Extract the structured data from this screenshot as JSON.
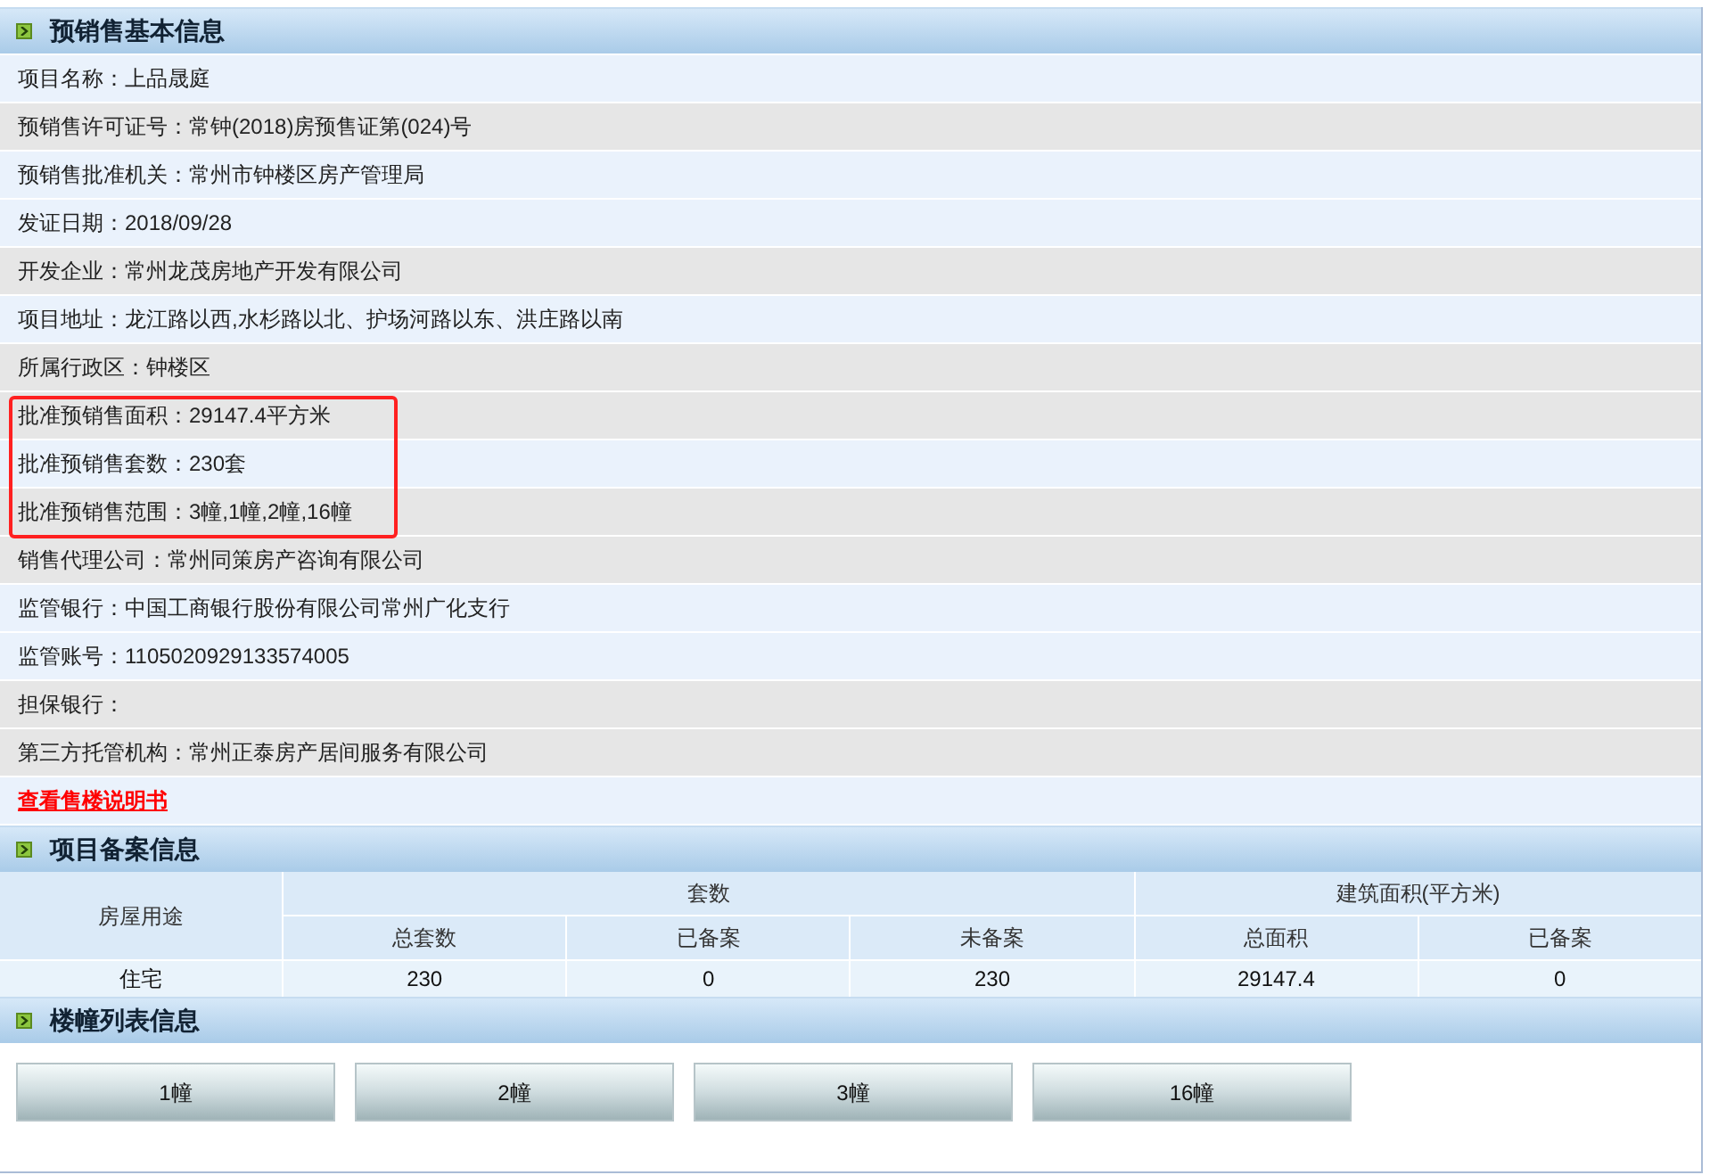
{
  "basic_info": {
    "title": "预销售基本信息",
    "rows": [
      {
        "kind": "field",
        "label": "项目名称：",
        "value": "上品晟庭",
        "color": "#eaf2fc"
      },
      {
        "kind": "field",
        "label": "预销售许可证号：",
        "value": "常钟(2018)房预售证第(024)号",
        "color": "#e6e6e6"
      },
      {
        "kind": "field",
        "label": "预销售批准机关：",
        "value": "常州市钟楼区房产管理局",
        "color": "#eaf2fc"
      },
      {
        "kind": "field",
        "label": "发证日期：",
        "value": "2018/09/28",
        "color": "#eaf2fc"
      },
      {
        "kind": "field",
        "label": "开发企业：",
        "value": "常州龙茂房地产开发有限公司",
        "color": "#e6e6e6"
      },
      {
        "kind": "field",
        "label": "项目地址：",
        "value": "龙江路以西,水杉路以北、护场河路以东、洪庄路以南",
        "color": "#eaf2fc"
      },
      {
        "kind": "field",
        "label": "所属行政区：",
        "value": "钟楼区",
        "color": "#e6e6e6"
      },
      {
        "kind": "highlight",
        "rows": [
          {
            "kind": "field",
            "label": "批准预销售面积：",
            "value": "29147.4平方米",
            "color": "#e6e6e6"
          },
          {
            "kind": "field",
            "label": "批准预销售套数：",
            "value": "230套",
            "color": "#eaf2fc"
          },
          {
            "kind": "field",
            "label": "批准预销售范围：",
            "value": "3幢,1幢,2幢,16幢",
            "color": "#e6e6e6"
          }
        ]
      },
      {
        "kind": "field",
        "label": "销售代理公司：",
        "value": "常州同策房产咨询有限公司",
        "color": "#e6e6e6"
      },
      {
        "kind": "field",
        "label": "监管银行：",
        "value": "中国工商银行股份有限公司常州广化支行",
        "color": "#eaf2fc"
      },
      {
        "kind": "field",
        "label": "监管账号：",
        "value": "1105020929133574005",
        "color": "#eaf2fc"
      },
      {
        "kind": "field",
        "label": "担保银行：",
        "color": "#e6e6e6"
      },
      {
        "kind": "field",
        "label": "第三方托管机构：",
        "value": "常州正泰房产居间服务有限公司",
        "color": "#e6e6e6"
      },
      {
        "kind": "link",
        "label": "查看售楼说明书",
        "color": "#eaf2fc"
      }
    ]
  },
  "record_info": {
    "title": "项目备案信息",
    "group_headers": [
      "房屋用途",
      "套数",
      "建筑面积(平方米)"
    ],
    "columns": [
      "",
      "总套数",
      "已备案",
      "未备案",
      "总面积",
      "已备案"
    ],
    "rows": [
      [
        "住宅",
        "230",
        "0",
        "230",
        "29147.4",
        "0"
      ]
    ]
  },
  "building_list": {
    "title": "楼幢列表信息",
    "buttons": [
      "1幢",
      "2幢",
      "3幢",
      "16幢"
    ]
  }
}
